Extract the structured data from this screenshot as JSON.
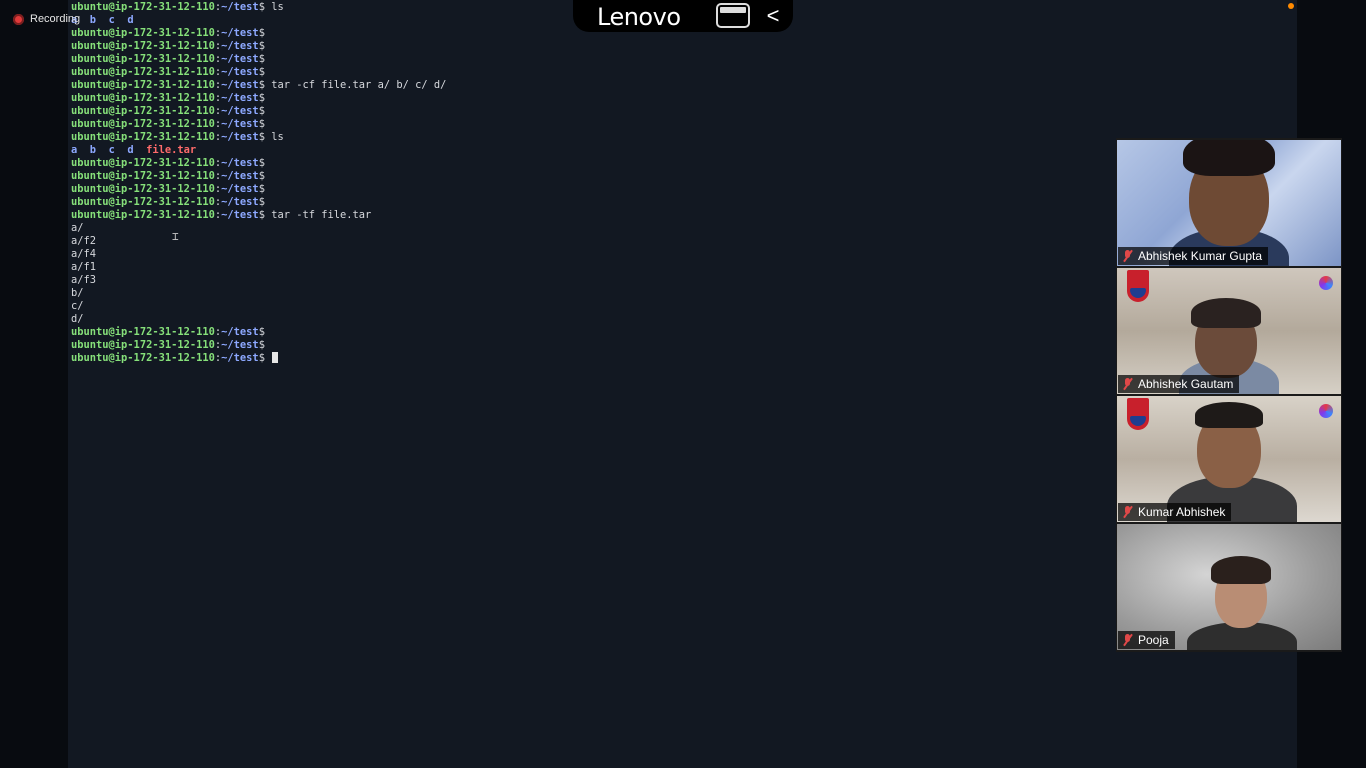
{
  "recording": {
    "label": "Recording"
  },
  "top_bar": {
    "brand": "Lenovo",
    "back_glyph": "<"
  },
  "terminal": {
    "prompt": {
      "user_host": "ubuntu@ip-172-31-12-110",
      "sep": ":",
      "path": "~/test",
      "symbol": "$"
    },
    "lines": [
      {
        "type": "prompt",
        "cmd": " ls"
      },
      {
        "type": "listing",
        "entries": [
          "a",
          "b",
          "c",
          "d"
        ]
      },
      {
        "type": "prompt",
        "cmd": ""
      },
      {
        "type": "prompt",
        "cmd": ""
      },
      {
        "type": "prompt",
        "cmd": ""
      },
      {
        "type": "prompt",
        "cmd": ""
      },
      {
        "type": "prompt",
        "cmd": " tar -cf file.tar a/ b/ c/ d/"
      },
      {
        "type": "prompt",
        "cmd": ""
      },
      {
        "type": "prompt",
        "cmd": ""
      },
      {
        "type": "prompt",
        "cmd": ""
      },
      {
        "type": "prompt",
        "cmd": " ls"
      },
      {
        "type": "listing",
        "entries": [
          "a",
          "b",
          "c",
          "d"
        ],
        "archive": "file.tar"
      },
      {
        "type": "prompt",
        "cmd": ""
      },
      {
        "type": "prompt",
        "cmd": ""
      },
      {
        "type": "prompt",
        "cmd": ""
      },
      {
        "type": "prompt",
        "cmd": ""
      },
      {
        "type": "prompt",
        "cmd": " tar -tf file.tar"
      },
      {
        "type": "output",
        "text": "a/"
      },
      {
        "type": "output",
        "text": "a/f2"
      },
      {
        "type": "output",
        "text": "a/f4"
      },
      {
        "type": "output",
        "text": "a/f1"
      },
      {
        "type": "output",
        "text": "a/f3"
      },
      {
        "type": "output",
        "text": "b/"
      },
      {
        "type": "output",
        "text": "c/"
      },
      {
        "type": "output",
        "text": "d/"
      },
      {
        "type": "prompt",
        "cmd": ""
      },
      {
        "type": "prompt",
        "cmd": ""
      },
      {
        "type": "prompt",
        "cmd": " ",
        "cursor": true
      }
    ]
  },
  "participants": [
    {
      "name": "Abhishek Kumar Gupta",
      "mic": "muted"
    },
    {
      "name": "Abhishek Gautam",
      "mic": "muted"
    },
    {
      "name": "Kumar Abhishek",
      "mic": "muted"
    },
    {
      "name": "Pooja",
      "mic": "muted"
    }
  ],
  "colors": {
    "prompt_user": "#86e07a",
    "prompt_path": "#8da8ff",
    "archive": "#ff6b6b",
    "mic_muted": "#e04848",
    "recording": "#e03a3a",
    "notification": "#ff8a00"
  }
}
